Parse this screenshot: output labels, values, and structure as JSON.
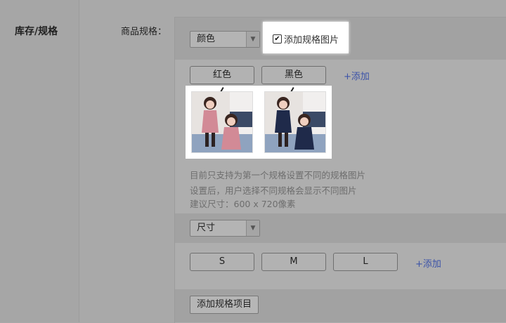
{
  "section": {
    "title": "库存/规格"
  },
  "spec_field": {
    "label": "商品规格："
  },
  "spec_groups": [
    {
      "select_value": "颜色",
      "checkbox": {
        "label": "添加规格图片",
        "checked": true
      },
      "values": [
        "红色",
        "黑色"
      ],
      "add_label": "+添加",
      "images": [
        {
          "icon": "product-photo-pink-coat",
          "caption": [
            "NEW KIDS",
            "2020 FASHION"
          ]
        },
        {
          "icon": "product-photo-navy-coat",
          "caption": [
            "NEW KIDS",
            "2020 FASHION"
          ]
        }
      ],
      "hints": [
        "目前只支持为第一个规格设置不同的规格图片",
        "设置后，用户选择不同规格会显示不同图片",
        "建议尺寸：600 x 720像素"
      ]
    },
    {
      "select_value": "尺寸",
      "values": [
        "S",
        "M",
        "L"
      ],
      "add_label": "+添加"
    }
  ],
  "actions": {
    "add_spec_item": "添加规格项目"
  },
  "colors": {
    "link": "#3b52a8",
    "overlay": "#a9a9a9",
    "highlight": "#ffffff"
  }
}
